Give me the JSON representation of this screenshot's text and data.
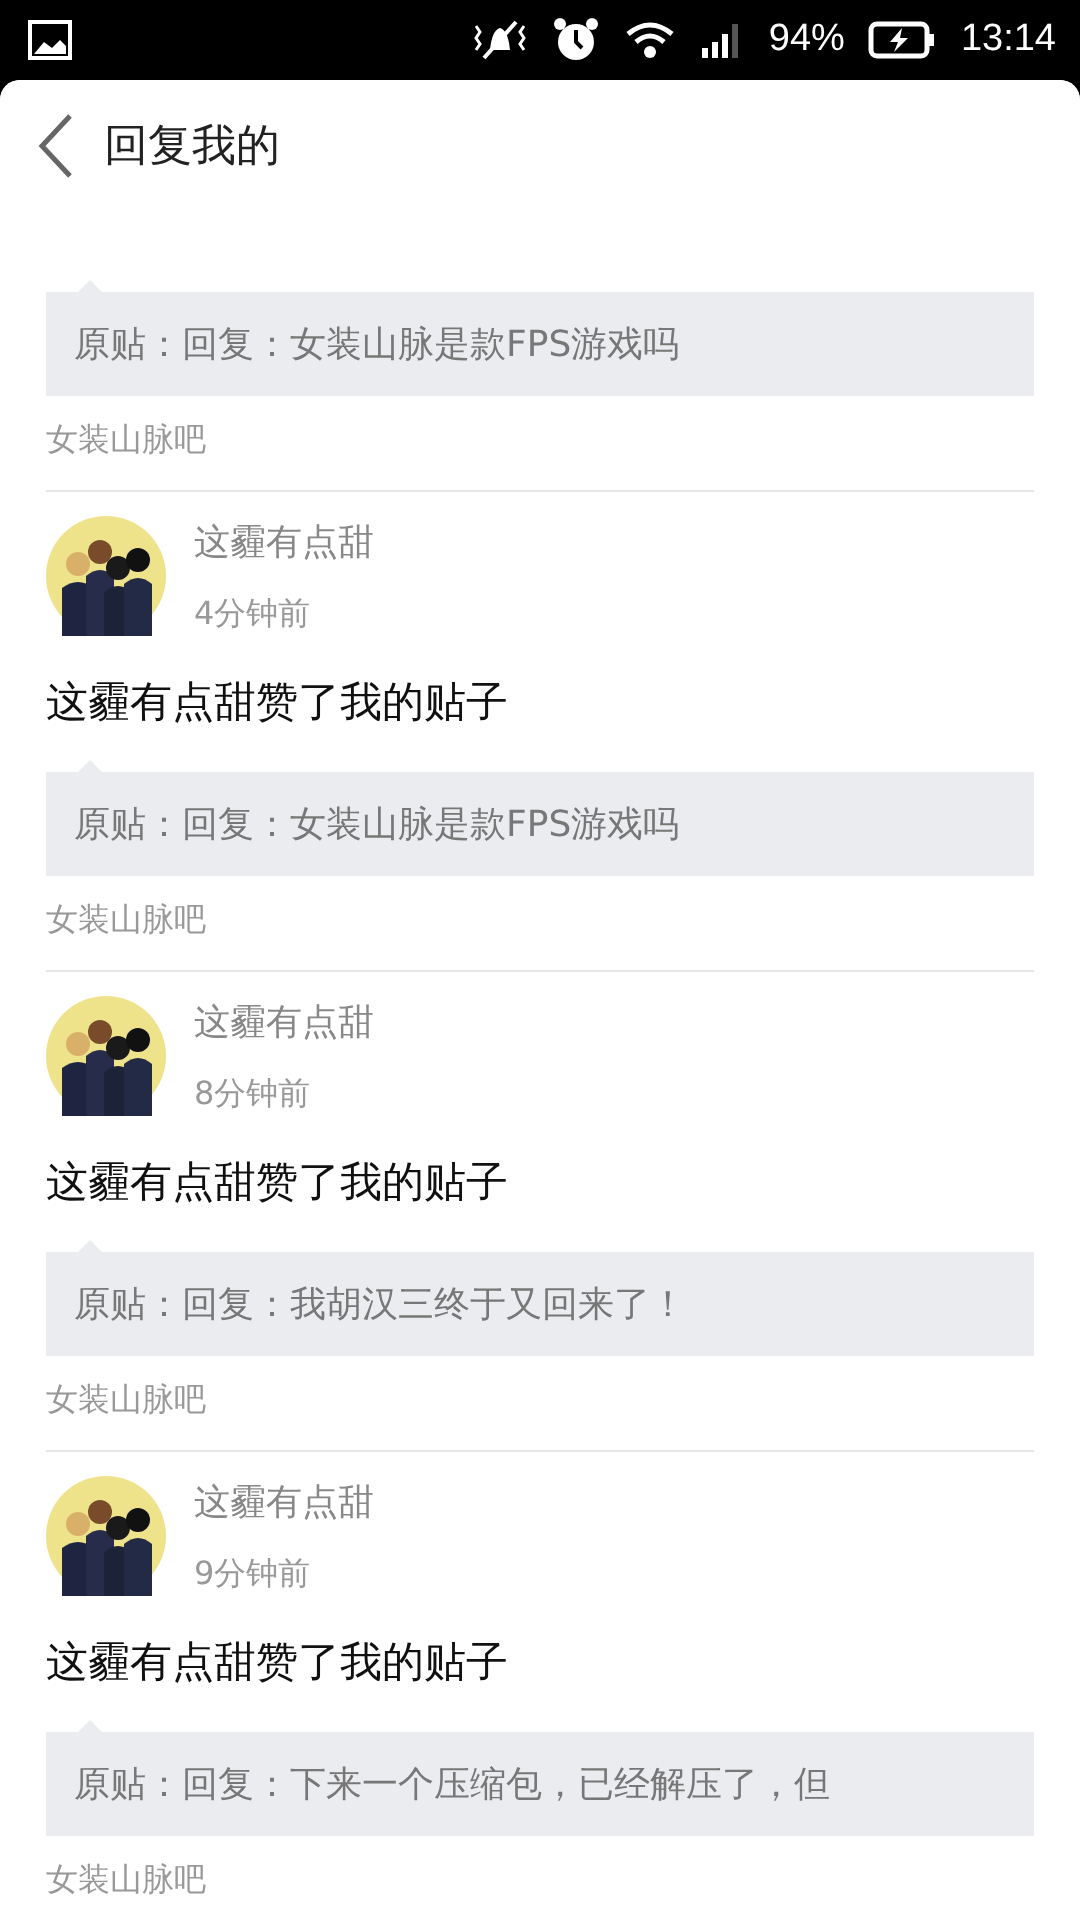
{
  "status_bar": {
    "battery": "94%",
    "time": "13:14"
  },
  "header": {
    "back": true,
    "title": "回复我的"
  },
  "notifications": [
    {
      "kind": "partial",
      "quote": "原贴：回复：女装山脉是款FPS游戏吗",
      "forum": "女装山脉吧"
    },
    {
      "kind": "full",
      "user": "这霾有点甜",
      "time": "4分钟前",
      "action": "这霾有点甜赞了我的贴子",
      "quote": "原贴：回复：女装山脉是款FPS游戏吗",
      "forum": "女装山脉吧"
    },
    {
      "kind": "full",
      "user": "这霾有点甜",
      "time": "8分钟前",
      "action": "这霾有点甜赞了我的贴子",
      "quote": "原贴：回复：我胡汉三终于又回来了！",
      "forum": "女装山脉吧"
    },
    {
      "kind": "full",
      "user": "这霾有点甜",
      "time": "9分钟前",
      "action": "这霾有点甜赞了我的贴子",
      "quote": "原贴：回复：下来一个压缩包，已经解压了，但",
      "forum": "女装山脉吧"
    }
  ]
}
